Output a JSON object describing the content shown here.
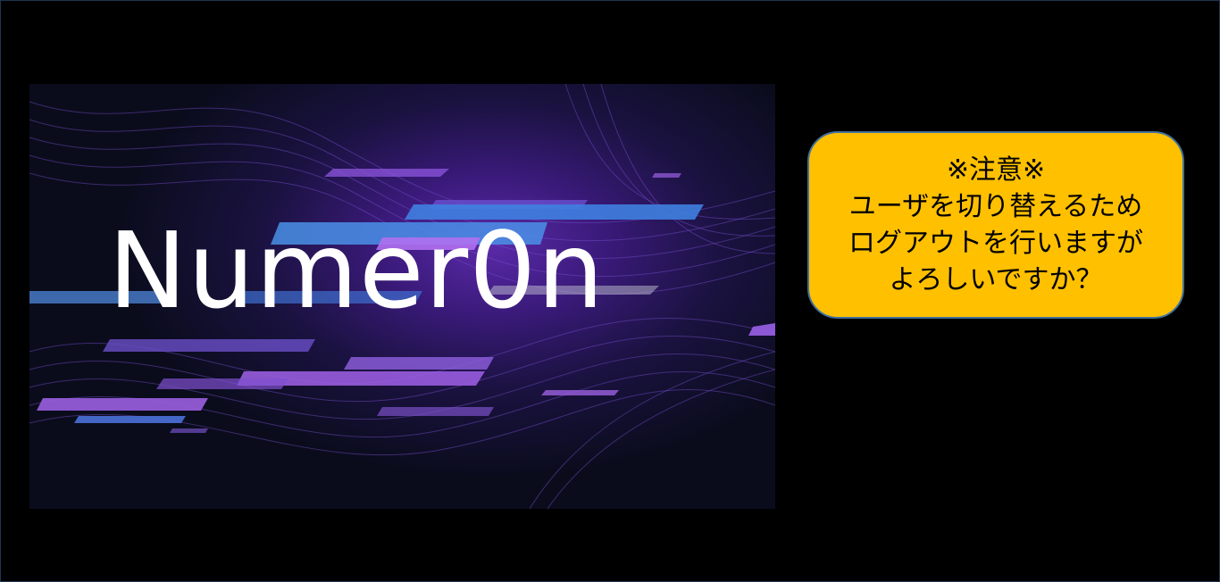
{
  "banner": {
    "title": "Numer0n"
  },
  "notice": {
    "lines": [
      "※注意※",
      "ユーザを切り替えるため",
      "ログアウトを行いますが",
      "よろしいですか？"
    ],
    "background_color": "#ffc000",
    "border_color": "#41719c"
  }
}
